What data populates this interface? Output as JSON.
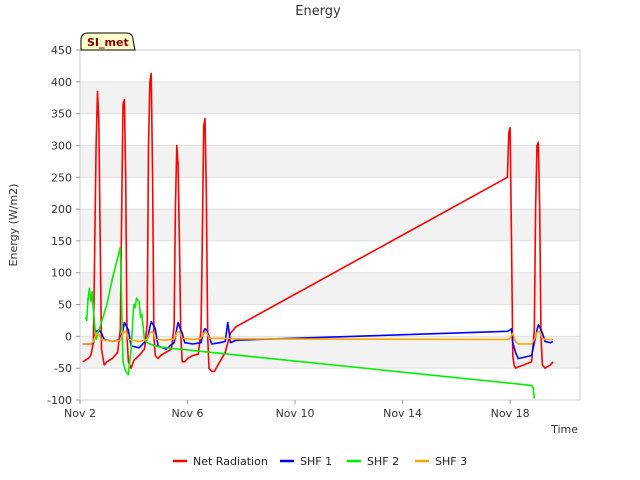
{
  "chart_data": {
    "type": "line",
    "title": "Energy",
    "xlabel": "Time",
    "ylabel": "Energy (W/m2)",
    "badge": "SI_met",
    "xlim": [
      2.0,
      20.6
    ],
    "ylim": [
      -100,
      450
    ],
    "yticks": [
      -100,
      -50,
      0,
      50,
      100,
      150,
      200,
      250,
      300,
      350,
      400,
      450
    ],
    "xticks": [
      {
        "value": 2,
        "label": "Nov 2"
      },
      {
        "value": 6,
        "label": "Nov 6"
      },
      {
        "value": 10,
        "label": "Nov 10"
      },
      {
        "value": 14,
        "label": "Nov 14"
      },
      {
        "value": 18,
        "label": "Nov 18"
      }
    ],
    "grid": "horizontal bands",
    "legend_position": "bottom",
    "series": [
      {
        "name": "Net Radiation",
        "color": "#ff0000",
        "x": [
          2.1,
          2.3,
          2.4,
          2.5,
          2.55,
          2.6,
          2.65,
          2.7,
          2.75,
          2.8,
          2.9,
          3.0,
          3.2,
          3.4,
          3.5,
          3.55,
          3.6,
          3.65,
          3.7,
          3.75,
          3.8,
          3.9,
          4.0,
          4.2,
          4.4,
          4.5,
          4.55,
          4.6,
          4.65,
          4.7,
          4.75,
          4.8,
          4.9,
          5.0,
          5.2,
          5.4,
          5.5,
          5.55,
          5.6,
          5.65,
          5.7,
          5.75,
          5.8,
          5.9,
          6.0,
          6.2,
          6.4,
          6.5,
          6.55,
          6.6,
          6.65,
          6.7,
          6.75,
          6.8,
          6.9,
          7.0,
          7.2,
          7.4,
          7.5,
          7.6,
          7.7,
          7.8,
          17.9,
          17.95,
          18.0,
          18.05,
          18.1,
          18.15,
          18.2,
          18.3,
          18.5,
          18.8,
          18.9,
          18.95,
          19.0,
          19.05,
          19.1,
          19.15,
          19.2,
          19.3,
          19.5,
          19.6
        ],
        "values": [
          -40,
          -35,
          -30,
          -10,
          150,
          300,
          385,
          340,
          150,
          -20,
          -45,
          -40,
          -35,
          -25,
          10,
          200,
          365,
          372,
          250,
          0,
          -40,
          -50,
          -38,
          -30,
          -20,
          20,
          300,
          400,
          413,
          250,
          0,
          -30,
          -35,
          -30,
          -25,
          -20,
          15,
          200,
          300,
          270,
          140,
          0,
          -40,
          -40,
          -35,
          -30,
          -28,
          10,
          150,
          330,
          342,
          230,
          0,
          -50,
          -55,
          -55,
          -40,
          -25,
          -10,
          5,
          10,
          15,
          250,
          320,
          328,
          150,
          -30,
          -45,
          -50,
          -48,
          -45,
          -40,
          10,
          200,
          300,
          305,
          200,
          0,
          -45,
          -50,
          -45,
          -40
        ]
      },
      {
        "name": "SHF 1",
        "color": "#0000ff",
        "x": [
          2.1,
          2.4,
          2.5,
          2.55,
          2.6,
          2.7,
          2.8,
          2.9,
          3.2,
          3.5,
          3.6,
          3.65,
          3.7,
          3.8,
          3.9,
          4.2,
          4.5,
          4.6,
          4.65,
          4.7,
          4.8,
          4.9,
          5.2,
          5.5,
          5.6,
          5.65,
          5.7,
          5.8,
          5.9,
          6.2,
          6.5,
          6.6,
          6.65,
          6.7,
          6.8,
          6.9,
          7.2,
          7.4,
          7.5,
          7.6,
          7.7,
          7.8,
          17.9,
          18.0,
          18.05,
          18.1,
          18.2,
          18.3,
          18.8,
          18.9,
          19.0,
          19.05,
          19.1,
          19.2,
          19.3,
          19.5,
          19.6
        ],
        "values": [
          -12,
          -12,
          -10,
          0,
          8,
          10,
          5,
          -5,
          -8,
          -5,
          10,
          22,
          18,
          10,
          -15,
          -18,
          -5,
          15,
          23,
          20,
          12,
          -15,
          -20,
          -10,
          12,
          22,
          15,
          5,
          -10,
          -12,
          -10,
          8,
          12,
          10,
          0,
          -12,
          -10,
          -8,
          22,
          -10,
          -8,
          -6,
          8,
          10,
          12,
          -10,
          -25,
          -35,
          -30,
          -10,
          10,
          18,
          15,
          5,
          -8,
          -10,
          -8
        ]
      },
      {
        "name": "SHF 2",
        "color": "#00ee00",
        "x": [
          2.2,
          2.25,
          2.3,
          2.35,
          2.4,
          2.45,
          2.5,
          2.6,
          3.0,
          3.2,
          3.5,
          3.6,
          3.7,
          3.8,
          3.9,
          4.0,
          4.05,
          4.1,
          4.2,
          4.25,
          4.3,
          4.4,
          4.5,
          4.6,
          4.8,
          5.0,
          18.8,
          18.85,
          18.88,
          18.9
        ],
        "values": [
          30,
          25,
          60,
          75,
          55,
          70,
          40,
          -5,
          50,
          90,
          140,
          -40,
          -55,
          -60,
          -20,
          50,
          45,
          60,
          55,
          30,
          35,
          -5,
          -10,
          -12,
          -15,
          -17,
          -77,
          -80,
          -90,
          -98
        ]
      },
      {
        "name": "SHF 3",
        "color": "#ffa500",
        "x": [
          2.1,
          2.4,
          2.5,
          2.6,
          2.7,
          2.8,
          3.2,
          3.5,
          3.6,
          3.7,
          3.8,
          4.2,
          4.5,
          4.6,
          4.7,
          4.8,
          5.2,
          5.5,
          5.6,
          5.7,
          5.8,
          6.2,
          6.5,
          6.6,
          6.7,
          6.8,
          7.2,
          7.5,
          7.8,
          17.9,
          18.0,
          18.1,
          18.2,
          18.3,
          18.8,
          18.9,
          19.0,
          19.1,
          19.2,
          19.3,
          19.6
        ],
        "values": [
          -12,
          -12,
          -8,
          5,
          3,
          -5,
          -8,
          -6,
          5,
          8,
          -5,
          -8,
          -5,
          5,
          8,
          -5,
          -6,
          -4,
          6,
          8,
          -3,
          -5,
          -3,
          5,
          7,
          -3,
          -3,
          -3,
          -4,
          -5,
          -3,
          5,
          -8,
          -12,
          -12,
          -5,
          6,
          8,
          -3,
          -5,
          -5
        ]
      }
    ]
  }
}
